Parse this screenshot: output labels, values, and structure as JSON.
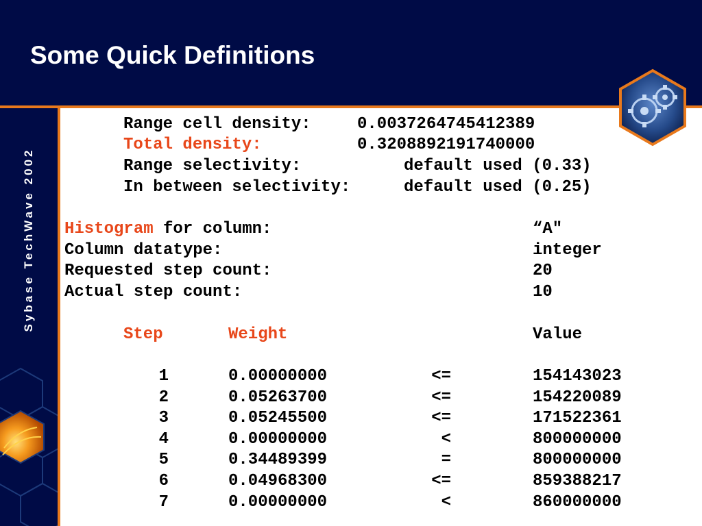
{
  "slide": {
    "title": "Some Quick Definitions",
    "vertical_label": "Sybase TechWave 2002"
  },
  "stats": [
    {
      "label": "Range cell density:",
      "value": "0.0037264745412389",
      "highlight": false
    },
    {
      "label": "Total density:",
      "value": "0.3208892191740000",
      "highlight": true
    },
    {
      "label": "Range selectivity:",
      "value": "default used (0.33)",
      "highlight": false
    },
    {
      "label": "In between selectivity:",
      "value": "default used (0.25)",
      "highlight": false
    }
  ],
  "histogram": {
    "title_red": "Histogram",
    "title_rest": " for column:",
    "column": "“A\"",
    "datatype_label": "Column datatype:",
    "datatype": "integer",
    "requested_label": "Requested step count:",
    "requested": "20",
    "actual_label": "Actual step count:",
    "actual": "10"
  },
  "table": {
    "headers": {
      "step": "Step",
      "weight": "Weight",
      "value": "Value"
    },
    "rows": [
      {
        "step": "1",
        "weight": "0.00000000",
        "op": "<=",
        "value": "154143023"
      },
      {
        "step": "2",
        "weight": "0.05263700",
        "op": "<=",
        "value": "154220089"
      },
      {
        "step": "3",
        "weight": "0.05245500",
        "op": "<=",
        "value": "171522361"
      },
      {
        "step": "4",
        "weight": "0.00000000",
        "op": "<",
        "value": "800000000"
      },
      {
        "step": "5",
        "weight": "0.34489399",
        "op": "=",
        "value": "800000000"
      },
      {
        "step": "6",
        "weight": "0.04968300",
        "op": "<=",
        "value": "859388217"
      },
      {
        "step": "7",
        "weight": "0.00000000",
        "op": "<",
        "value": "860000000"
      }
    ]
  },
  "colors": {
    "navy": "#000b46",
    "accent_orange": "#e8791c",
    "highlight_red": "#e8471a"
  },
  "icons": {
    "logo": "gears-hexagon-icon"
  }
}
